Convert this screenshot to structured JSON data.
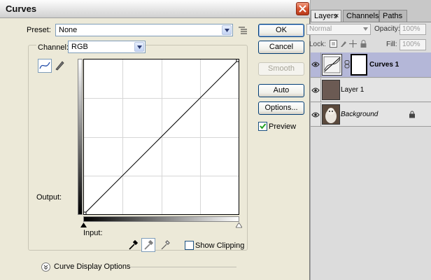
{
  "dialog": {
    "title": "Curves",
    "preset_label": "Preset:",
    "preset_value": "None",
    "channel_label": "Channel:",
    "channel_value": "RGB",
    "output_label": "Output:",
    "input_label": "Input:",
    "show_clipping_label": "Show Clipping",
    "show_clipping_checked": false,
    "curve_display_label": "Curve Display Options",
    "buttons": {
      "ok": "OK",
      "cancel": "Cancel",
      "smooth": "Smooth",
      "auto": "Auto",
      "options": "Options..."
    },
    "preview_label": "Preview",
    "preview_checked": true
  },
  "curve": {
    "points": [
      [
        0,
        0
      ],
      [
        255,
        255
      ]
    ]
  },
  "layers_panel": {
    "tabs": [
      "Layers",
      "Channels",
      "Paths"
    ],
    "blend_mode": "Normal",
    "opacity_label": "Opacity:",
    "opacity_value": "100%",
    "lock_label": "Lock:",
    "fill_label": "Fill:",
    "fill_value": "100%",
    "layers": [
      {
        "name": "Curves 1",
        "selected": true
      },
      {
        "name": "Layer 1",
        "selected": false
      },
      {
        "name": "Background",
        "selected": false
      }
    ],
    "layer1_color": "#6b5a53"
  }
}
